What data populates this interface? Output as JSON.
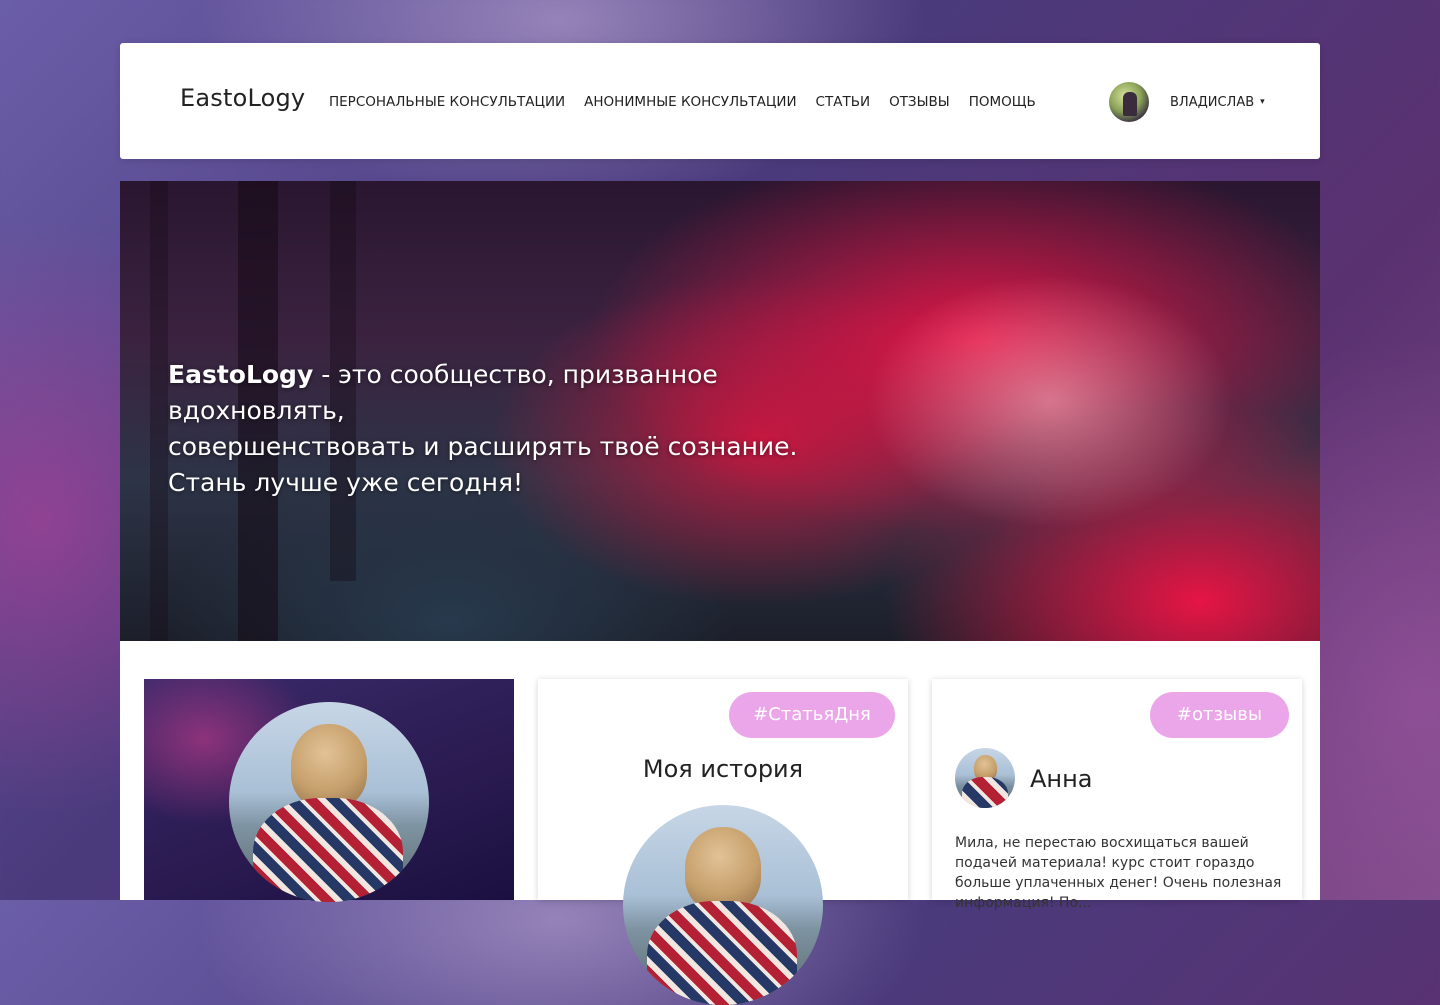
{
  "navbar": {
    "logo": "EastoLogy",
    "links": [
      "ПЕРСОНАЛЬНЫЕ КОНСУЛЬТАЦИИ",
      "АНОНИМНЫЕ КОНСУЛЬТАЦИИ",
      "СТАТЬИ",
      "ОТЗЫВЫ",
      "ПОМОЩЬ"
    ],
    "user": {
      "name": "ВЛАДИСЛАВ",
      "caret": "▾"
    }
  },
  "hero": {
    "brand": "EastoLogy",
    "line1_rest": " - это сообщество, призванное вдохновлять,",
    "line2": "совершенствовать и расширять твоё сознание.",
    "line3": "Стань лучше уже сегодня!"
  },
  "article_card": {
    "tag": "#СтатьяДня",
    "title": "Моя история"
  },
  "review_card": {
    "tag": "#отзывы",
    "name": "Анна",
    "text": "Мила, не перестаю восхищаться вашей подачей материала! курс стоит гораздо больше уплаченных денег! Очень полезная информация! По..."
  },
  "colors": {
    "tag_bg": "#eba6ea",
    "hero_accent": "#e8174a"
  }
}
